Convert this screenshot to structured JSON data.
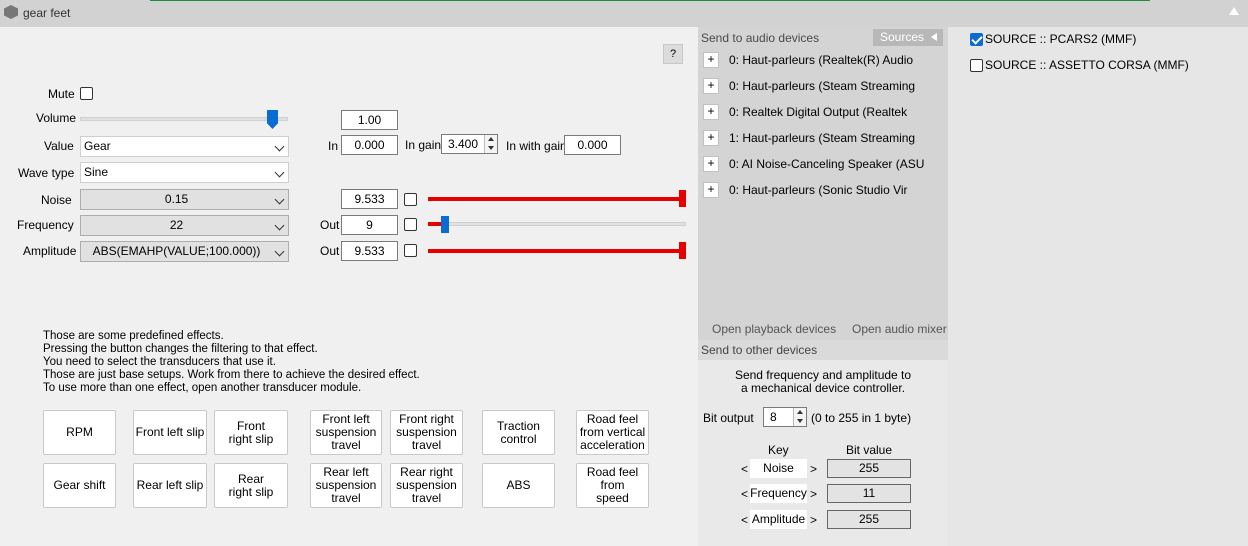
{
  "window": {
    "title": "gear feet"
  },
  "help_label": "?",
  "mute": {
    "label": "Mute",
    "checked": false
  },
  "volume": {
    "label": "Volume",
    "value": "1.00",
    "level": 0.95
  },
  "value": {
    "label": "Value",
    "selected": "Gear",
    "in_label": "In",
    "in_value": "0.000",
    "in_gain_label": "In gain",
    "in_gain_value": "3.400",
    "with_gain_label": "In with gain",
    "with_gain_value": "0.000"
  },
  "wave_type": {
    "label": "Wave type",
    "selected": "Sine"
  },
  "noise": {
    "label": "Noise",
    "selected": "0.15",
    "value": "9.533",
    "checked": false,
    "level": 1.0
  },
  "frequency": {
    "label": "Frequency",
    "selected": "22",
    "out_label": "Out",
    "out_value": "9",
    "checked": false,
    "level": 0.05
  },
  "amplitude": {
    "label": "Amplitude",
    "selected": "ABS(EMAHP(VALUE;100.000))",
    "out_label": "Out",
    "out_value": "9.533",
    "checked": false,
    "level": 1.0
  },
  "description": "Those are some predefined effects.\nPressing the button changes the filtering to that effect.\nYou need to select the transducers that use it.\nThose are just base setups. Work from there to achieve the desired effect.\nTo use more than one effect, open another transducer module.",
  "effects": {
    "rpm": "RPM",
    "gear_shift": "Gear shift",
    "front_left_slip": "Front left slip",
    "rear_left_slip": "Rear left slip",
    "front_right_slip": "Front right slip",
    "rear_right_slip": "Rear right slip",
    "front_left_susp": "Front left suspension travel",
    "rear_left_susp": "Rear left suspension travel",
    "front_right_susp": "Front right suspension travel",
    "rear_right_susp": "Rear right suspension travel",
    "traction_control": "Traction control",
    "abs": "ABS",
    "road_feel_vertical": "Road feel from vertical acceleration",
    "road_feel_speed": "Road feel from speed"
  },
  "audio": {
    "header": "Send to audio devices",
    "sources_tab": "Sources",
    "plus": "+",
    "devices": [
      "0: Haut-parleurs (Realtek(R) Audio",
      "0: Haut-parleurs (Steam Streaming",
      "0: Realtek Digital Output (Realtek",
      "1: Haut-parleurs (Steam Streaming",
      "0: AI Noise-Canceling Speaker (ASU",
      "0: Haut-parleurs (Sonic Studio Vir"
    ],
    "open_playback": "Open playback devices",
    "open_mixer": "Open audio mixer"
  },
  "other": {
    "header": "Send to other devices",
    "info_line1": "Send frequency and amplitude to",
    "info_line2": "a mechanical device controller.",
    "bit_output_label": "Bit output",
    "bit_output_value": "8",
    "bit_output_hint": "(0 to 255 in 1 byte)",
    "key_header": "Key",
    "bit_value_header": "Bit value",
    "lt": "<",
    "gt": ">",
    "rows": [
      {
        "key": "Noise",
        "value": "255"
      },
      {
        "key": "Frequency",
        "value": "11"
      },
      {
        "key": "Amplitude",
        "value": "255"
      }
    ]
  },
  "sources": [
    {
      "label": "SOURCE :: PCARS2 (MMF)",
      "checked": true
    },
    {
      "label": "SOURCE :: ASSETTO CORSA (MMF)",
      "checked": false
    }
  ],
  "colors": {
    "accent": "#0a6bd4",
    "level_bar": "#e60000"
  }
}
